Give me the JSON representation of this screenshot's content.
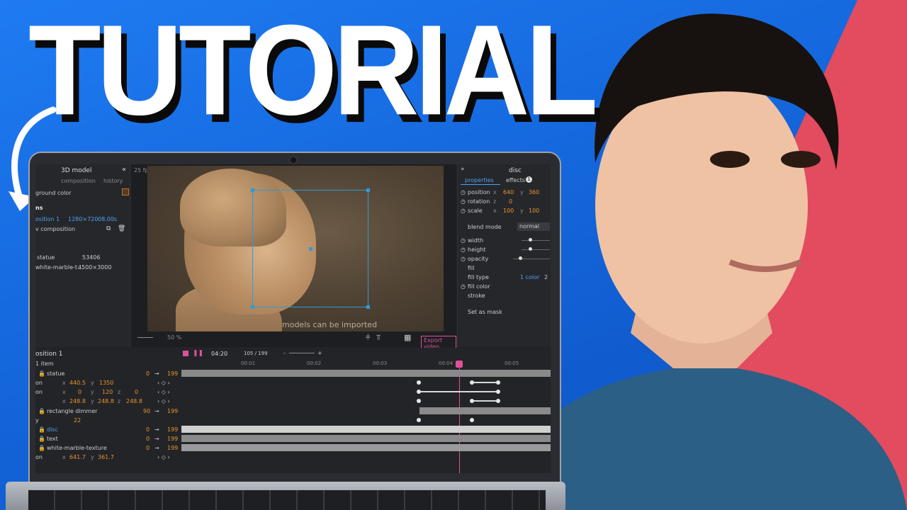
{
  "thumbnail": {
    "title": "TUTORIAL",
    "colors": {
      "bg_blue": "#1a6fe0",
      "accent_red": "#e34b5f"
    }
  },
  "left_panel": {
    "title": "3D model",
    "collapse_icon": "double-chevron-left-icon",
    "tabs": [
      "composition",
      "history"
    ],
    "background_label": "ground color",
    "section": "ns",
    "composition_row": {
      "name": "osition 1",
      "size": "1280×720",
      "duration": "08.00s"
    },
    "new_composition": "v composition",
    "assets": [
      {
        "name": "statue",
        "info": "53406"
      },
      {
        "name": "white-marble-t...",
        "info": "4500×3000"
      }
    ]
  },
  "viewport": {
    "fps": "25 fps",
    "overlay_text": "models can be imported",
    "zoom": "50 %",
    "export_label": "Export video"
  },
  "right_panel": {
    "title": "disc",
    "tabs": [
      {
        "label": "properties"
      },
      {
        "label": "effects",
        "badge": "1"
      }
    ],
    "position": {
      "label": "position",
      "x": "640",
      "y": "360"
    },
    "rotation": {
      "label": "rotation",
      "z": "0"
    },
    "scale": {
      "label": "scale",
      "x": "100",
      "y": "100"
    },
    "blend_mode": {
      "label": "blend mode",
      "value": "normal"
    },
    "width_label": "width",
    "height_label": "height",
    "opacity_label": "opacity",
    "fill_label": "fill",
    "fill_type": {
      "label": "fill type",
      "value": "1 color",
      "extra": "2"
    },
    "fill_color_label": "fill color",
    "stroke_label": "stroke",
    "mask_label": "Set as mask"
  },
  "timeline": {
    "comp_name": "osition 1",
    "time": "04:20",
    "frames": "105 / 199",
    "minus": "-",
    "plus": "+",
    "selected_count": "1 item",
    "ruler": [
      "00:01",
      "00:02",
      "00:03",
      "00:04",
      "00:05"
    ],
    "layers": [
      {
        "name": "statue",
        "in": "0",
        "out": "199",
        "type": "layer"
      },
      {
        "name": "on",
        "x": "440.5",
        "y": "1350",
        "type": "prop"
      },
      {
        "name": "on",
        "x": "0",
        "y": "120",
        "z": "0",
        "type": "prop3"
      },
      {
        "name": "",
        "x": "248.8",
        "y": "248.8",
        "z": "248.8",
        "type": "prop3"
      },
      {
        "name": "rectangle dimmer",
        "in": "90",
        "out": "199",
        "type": "layer"
      },
      {
        "name": "y",
        "value": "22",
        "type": "single"
      },
      {
        "name": "disc",
        "in": "0",
        "out": "199",
        "type": "layer",
        "selected": true
      },
      {
        "name": "text",
        "in": "0",
        "out": "199",
        "type": "layer"
      },
      {
        "name": "white-marble-texture",
        "in": "0",
        "out": "199",
        "type": "layer"
      },
      {
        "name": "on",
        "x": "641.7",
        "y": "361.7",
        "type": "prop"
      }
    ]
  }
}
